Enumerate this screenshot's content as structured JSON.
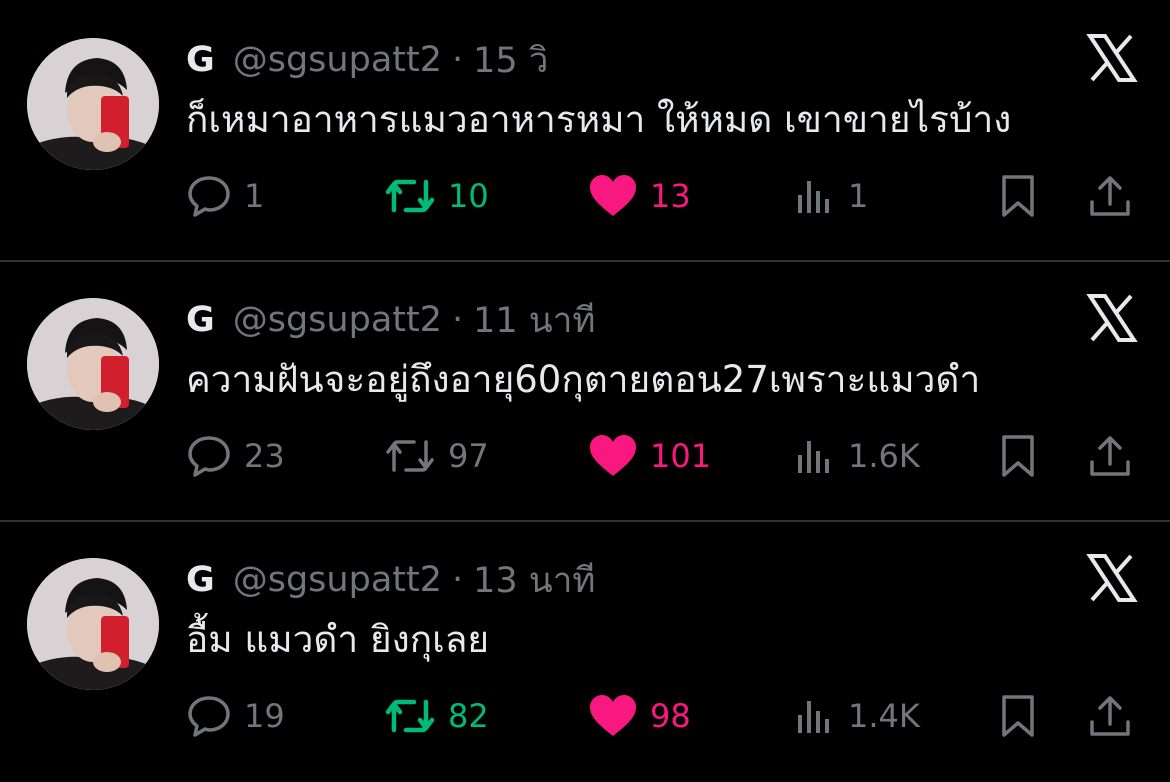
{
  "colors": {
    "background": "#000000",
    "text": "#e7e9ea",
    "muted": "#71767b",
    "retweet_active": "#00ba7c",
    "like_active": "#f91880",
    "divider": "#2f3336"
  },
  "tweets": [
    {
      "name": "G",
      "handle": "@sgsupatt2",
      "separator": "·",
      "time": "15 วิ",
      "text": "ก็เหมาอาหารแมวอาหารหมา ให้หมด เขาขายไรบ้าง",
      "replies": "1",
      "retweets": "10",
      "retweeted": true,
      "likes": "13",
      "liked": true,
      "views": "1",
      "icons": [
        "reply-icon",
        "retweet-icon",
        "heart-icon",
        "views-icon",
        "bookmark-icon",
        "share-icon",
        "x-logo-icon"
      ]
    },
    {
      "name": "G",
      "handle": "@sgsupatt2",
      "separator": "·",
      "time": "11 นาที",
      "text": "ความฝันจะอยู่ถึงอายุ60กุตายตอน27เพราะแมวดำ",
      "replies": "23",
      "retweets": "97",
      "retweeted": false,
      "likes": "101",
      "liked": true,
      "views": "1.6K",
      "icons": [
        "reply-icon",
        "retweet-icon",
        "heart-icon",
        "views-icon",
        "bookmark-icon",
        "share-icon",
        "x-logo-icon"
      ]
    },
    {
      "name": "G",
      "handle": "@sgsupatt2",
      "separator": "·",
      "time": "13 นาที",
      "text": "อื้ม แมวดำ ยิงกุเลย",
      "replies": "19",
      "retweets": "82",
      "retweeted": true,
      "likes": "98",
      "liked": true,
      "views": "1.4K",
      "icons": [
        "reply-icon",
        "retweet-icon",
        "heart-icon",
        "views-icon",
        "bookmark-icon",
        "share-icon",
        "x-logo-icon"
      ]
    }
  ]
}
